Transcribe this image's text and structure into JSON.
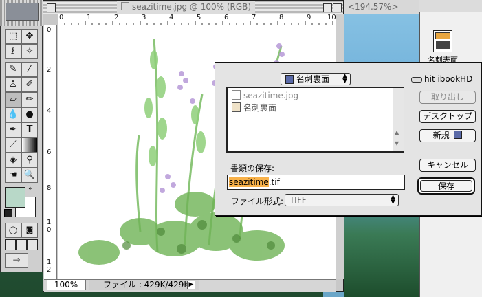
{
  "image_window": {
    "title": "seazitime.jpg @ 100% (RGB)",
    "zoom": "100%",
    "file_info": "ファイル : 429K/429K",
    "ruler_top": [
      "0",
      "1",
      "2",
      "3",
      "4",
      "5",
      "6",
      "7",
      "8",
      "9",
      "10"
    ],
    "ruler_left": [
      "0",
      "2",
      "4",
      "6",
      "8",
      "1\n0",
      "1\n2"
    ]
  },
  "background_window": {
    "title": "<194.57%>"
  },
  "finder": {
    "icon_label": "名刺表面"
  },
  "save_dialog": {
    "folder_name": "名刺裏面",
    "disk_name": "hit ibookHD",
    "files": [
      {
        "name": "seazitime.jpg",
        "dimmed": true
      },
      {
        "name": "名刺裏面",
        "dimmed": false
      }
    ],
    "buttons": {
      "eject": "取り出し",
      "desktop": "デスクトップ",
      "new": "新規",
      "cancel": "キャンセル",
      "save": "保存"
    },
    "save_as_label": "書類の保存:",
    "filename_selected": "seazitime",
    "filename_ext": ".tif",
    "format_label": "ファイル形式:",
    "format_value": "TIFF"
  },
  "colors": {
    "foreground": "#b8d8c8",
    "background": "#ffffff",
    "selection": "#f9b24a"
  }
}
